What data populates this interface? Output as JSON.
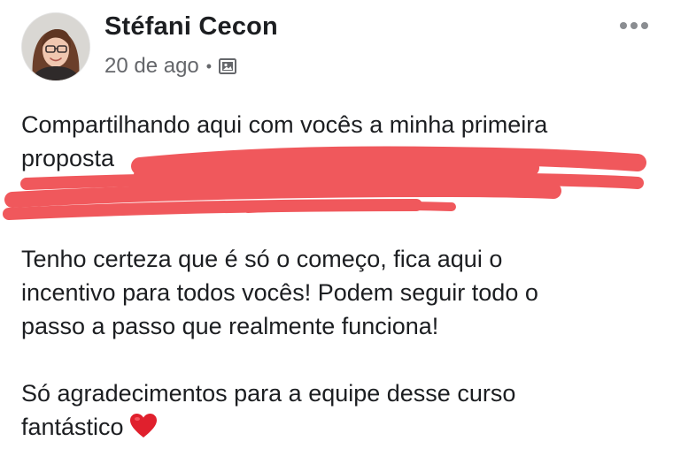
{
  "post": {
    "author": {
      "name": "Stéfani Cecon",
      "avatar": "profile-photo"
    },
    "timestamp": "20 de ago",
    "separator": "•",
    "audience_icon": "photo-album-icon",
    "more_icon": "more-options-icon",
    "paragraphs": {
      "p1_line1": "Compartilhando aqui com vocês a minha primeira",
      "p1_line2": "proposta",
      "p2_line1": "Tenho certeza que é só o começo, fica aqui o",
      "p2_line2": "incentivo para todos vocês! Podem seguir todo o",
      "p2_line3": "passo a passo que realmente funciona!",
      "p3_line1": "Só agradecimentos para a equipe desse curso",
      "p3_line2": "fantástico"
    },
    "emoji": "heart-emoji",
    "redaction_color": "#f0585c"
  }
}
